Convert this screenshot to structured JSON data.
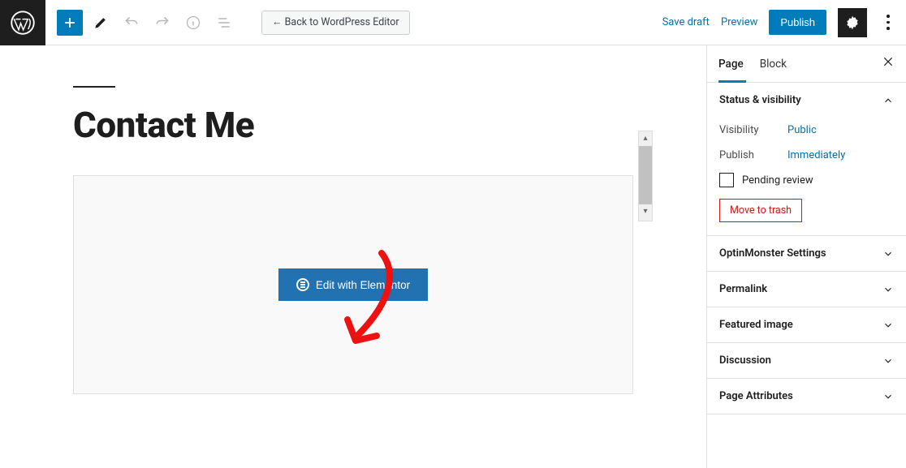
{
  "topbar": {
    "back_label": "← Back to WordPress Editor",
    "save_draft": "Save draft",
    "preview": "Preview",
    "publish": "Publish"
  },
  "canvas": {
    "page_title": "Contact Me",
    "elementor_button": "Edit with Elementor"
  },
  "sidebar": {
    "tabs": {
      "page": "Page",
      "block": "Block"
    },
    "panels": {
      "status": {
        "title": "Status & visibility",
        "visibility_label": "Visibility",
        "visibility_value": "Public",
        "publish_label": "Publish",
        "publish_value": "Immediately",
        "pending_review": "Pending review",
        "move_to_trash": "Move to trash"
      },
      "optinmonster": "OptinMonster Settings",
      "permalink": "Permalink",
      "featured_image": "Featured image",
      "discussion": "Discussion",
      "page_attributes": "Page Attributes"
    }
  }
}
